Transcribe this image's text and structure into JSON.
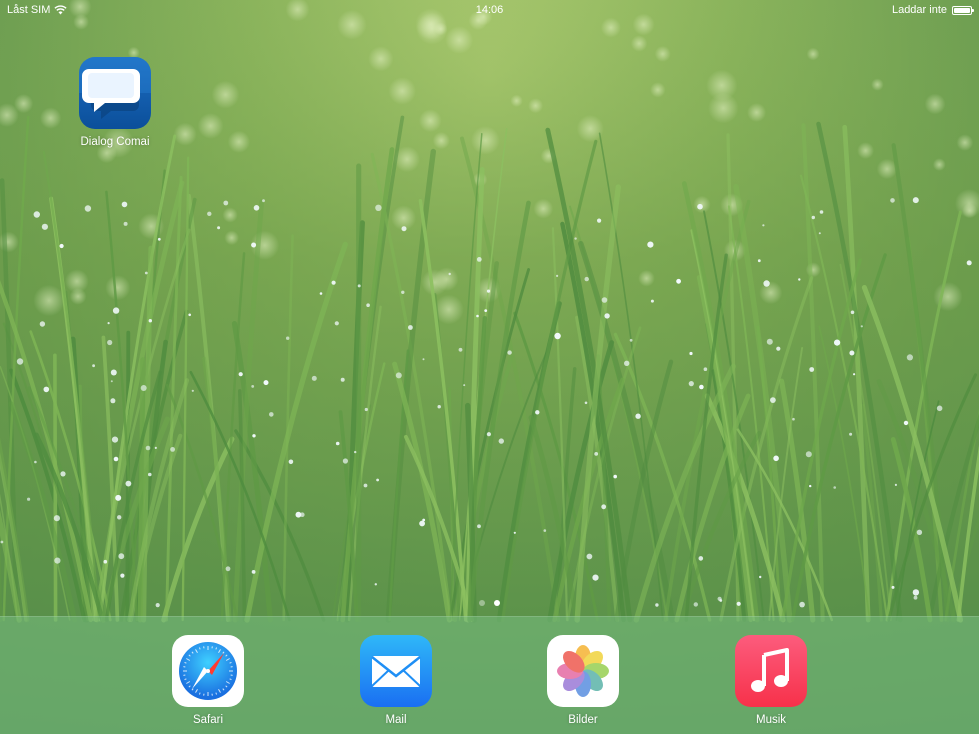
{
  "status_bar": {
    "carrier": "Låst SIM",
    "time": "14:06",
    "battery_status": "Laddar inte",
    "battery_level": 1.0
  },
  "home_screen": {
    "apps": [
      {
        "label": "Dialog Comai",
        "icon": "speech-bubbles-icon"
      }
    ],
    "page_count": 2,
    "active_page": 2
  },
  "dock": {
    "apps": [
      {
        "label": "Safari",
        "icon": "compass-icon"
      },
      {
        "label": "Mail",
        "icon": "envelope-icon"
      },
      {
        "label": "Bilder",
        "icon": "flower-icon"
      },
      {
        "label": "Musik",
        "icon": "music-note-icon"
      }
    ]
  },
  "colors": {
    "wallpaper": "#7fac58",
    "dock": "#78be82",
    "dialog_app": "#1462b6",
    "mail_app": "#1f8ff5",
    "music_app": "#f8405a"
  }
}
